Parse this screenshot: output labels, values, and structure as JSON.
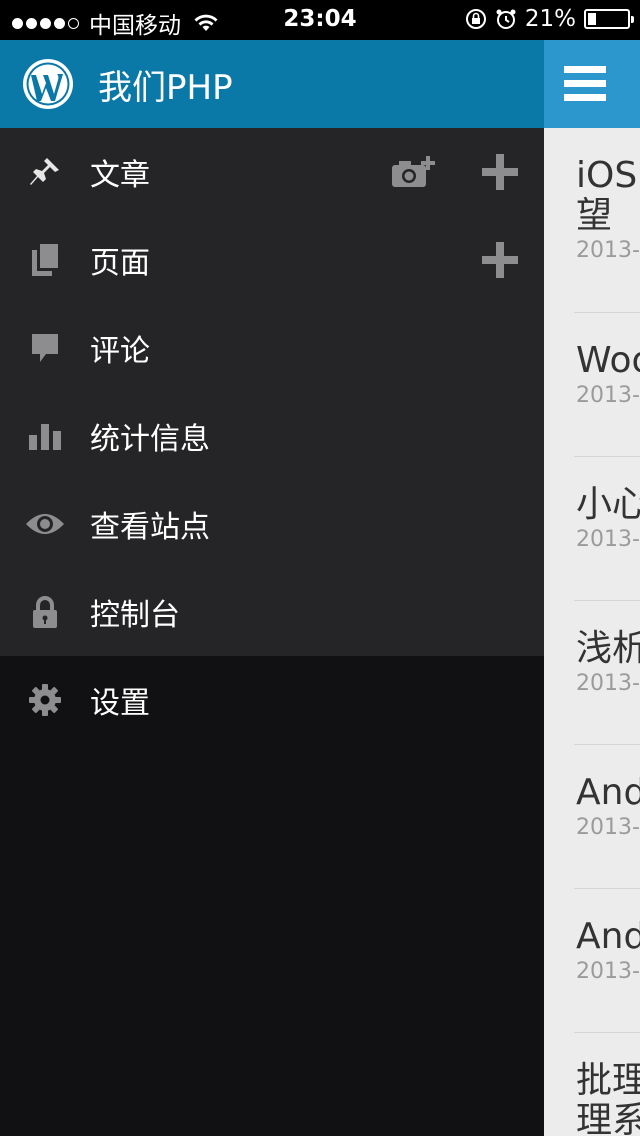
{
  "status_bar": {
    "carrier": "中国移动",
    "time": "23:04",
    "battery": "21%",
    "battery_level": 0.21
  },
  "site": {
    "title": "我们PHP"
  },
  "menu": {
    "items": [
      {
        "label": "文章",
        "icon": "pin-icon"
      },
      {
        "label": "页面",
        "icon": "pages-icon"
      },
      {
        "label": "评论",
        "icon": "comment-icon"
      },
      {
        "label": "统计信息",
        "icon": "stats-icon"
      },
      {
        "label": "查看站点",
        "icon": "eye-icon"
      },
      {
        "label": "控制台",
        "icon": "lock-icon"
      }
    ],
    "settings": {
      "label": "设置",
      "icon": "gear-icon"
    }
  },
  "posts": [
    {
      "title": "iOS\n望",
      "date": "2013-"
    },
    {
      "title": "Woo",
      "date": "2013-"
    },
    {
      "title": "小心",
      "date": "2013-"
    },
    {
      "title": "浅析",
      "date": "2013-"
    },
    {
      "title": "And",
      "date": "2013-"
    },
    {
      "title": "And",
      "date": "2013-"
    },
    {
      "title": "批理\n理系",
      "date": ""
    }
  ],
  "colors": {
    "header_blue": "#0b79a8",
    "content_header_blue": "#2c97cc",
    "drawer_bg": "#252527",
    "drawer_dark": "#111113"
  }
}
